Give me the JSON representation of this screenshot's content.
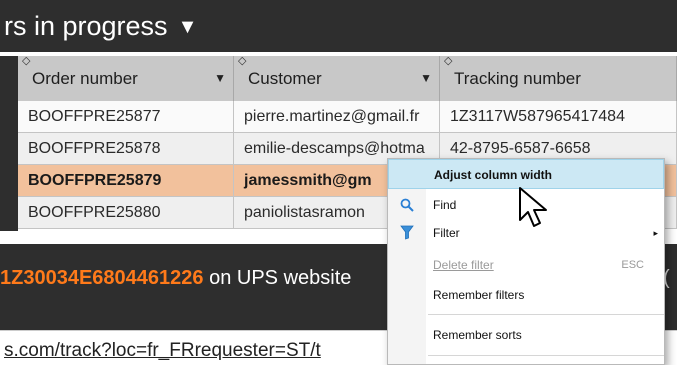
{
  "title": {
    "text": "rs in progress",
    "dropdown_glyph": "▼"
  },
  "table": {
    "columns": [
      {
        "label": "Order number"
      },
      {
        "label": "Customer"
      },
      {
        "label": "Tracking number"
      }
    ],
    "rows": [
      {
        "order": "BOOFFPRE25877",
        "customer": "pierre.martinez@gmail.fr",
        "tracking": "1Z3117W587965417484"
      },
      {
        "order": "BOOFFPRE25878",
        "customer": "emilie-descamps@hotma",
        "tracking": "42-8795-6587-6658"
      },
      {
        "order": "BOOFFPRE25879",
        "customer": "jamessmith@gm",
        "tracking": ""
      },
      {
        "order": "BOOFFPRE25880",
        "customer": "paniolistasramon",
        "tracking": ""
      }
    ]
  },
  "banner": {
    "code": "1Z30034E6804461226",
    "text": " on UPS website",
    "tail": "("
  },
  "url": {
    "text": "s.com/track?loc=fr_FRrequester=ST/t"
  },
  "context_menu": {
    "items": [
      {
        "label": "Adjust column width",
        "state": "highlighted"
      },
      {
        "label": "Find",
        "icon": "search-icon"
      },
      {
        "label": "Filter",
        "icon": "filter-icon",
        "submenu": "▸"
      },
      {
        "label": "Delete filter",
        "shortcut": "ESC",
        "state": "disabled"
      },
      {
        "label": "Remember filters"
      },
      {
        "label": "Remember sorts"
      }
    ]
  },
  "colors": {
    "dark_bar": "#2e2e2e",
    "selected_row": "#f2c19c",
    "tracking_code": "#ff7a1a",
    "menu_highlight": "#cce8f4",
    "find_icon": "#2a7fd4",
    "filter_icon": "#3a8fd8"
  }
}
